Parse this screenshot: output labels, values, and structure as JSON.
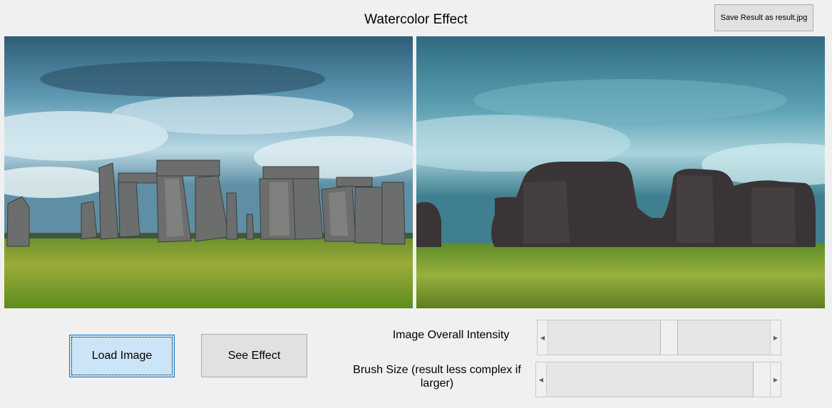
{
  "window": {
    "title": "Watercolor Effect"
  },
  "toolbar": {
    "save_label": "Save Result as result.jpg"
  },
  "images": {
    "original": {
      "icon": "stonehenge-photo"
    },
    "result": {
      "icon": "stonehenge-watercolor"
    }
  },
  "buttons": {
    "load_label": "Load Image",
    "effect_label": "See Effect"
  },
  "controls": {
    "intensity": {
      "label": "Image Overall Intensity",
      "value_fraction": 0.55
    },
    "brush": {
      "label": "Brush Size (result less complex if larger)",
      "value_fraction": 1.0
    }
  }
}
